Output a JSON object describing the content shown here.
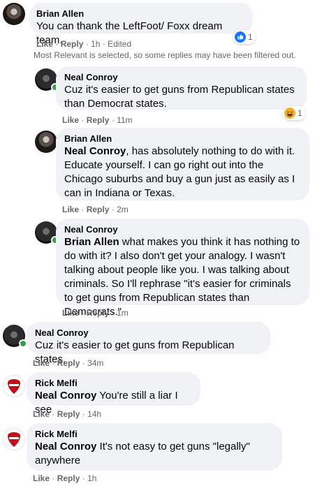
{
  "comments": [
    {
      "author": "Brian Allen",
      "mention": "",
      "text": "You can thank the LeftFoot/ Foxx dream team.",
      "like": "Like",
      "reply": "Reply",
      "time": "1h",
      "edited": "Edited",
      "reaction_count": "1",
      "reaction_type": "like-icon"
    },
    {
      "author": "Neal Conroy",
      "mention": "",
      "text": "Cuz it's easier to get guns from Republican states than Democrat states.",
      "like": "Like",
      "reply": "Reply",
      "time": "11m",
      "reaction_count": "1",
      "reaction_type": "haha-icon"
    },
    {
      "author": "Brian Allen",
      "mention": "Neal Conroy",
      "text": ", has absolutely nothing to do with it. Educate yourself. I can go right out into the Chicago suburbs and buy a gun just as easily as I can in Indiana or Texas.",
      "like": "Like",
      "reply": "Reply",
      "time": "2m"
    },
    {
      "author": "Neal Conroy",
      "mention": "Brian Allen",
      "text": " what makes you think it has nothing to do with it? I also don't get your analogy. I wasn't talking about people like you. I was talking about criminals. So I'll rephrase \"it's easier for criminals to get guns from Republican states than Democrats.\"",
      "like": "Like",
      "reply": "Reply",
      "time": "1m"
    },
    {
      "author": "Neal Conroy",
      "mention": "",
      "text": "Cuz it's easier to get guns from Republican states.",
      "like": "Like",
      "reply": "Reply",
      "time": "34m"
    },
    {
      "author": "Rick Melfi",
      "mention": "Neal Conroy",
      "text": " You're still a liar I see",
      "like": "Like",
      "reply": "Reply",
      "time": "14h"
    },
    {
      "author": "Rick Melfi",
      "mention": "Neal Conroy",
      "text": " It's not easy to get guns \"legally\" anywhere",
      "like": "Like",
      "reply": "Reply",
      "time": "1h"
    }
  ],
  "filter_notice": "Most Relevant is selected, so some replies may have been filtered out.",
  "separator": "·",
  "colors": {
    "bubble": "#f0f2f5",
    "meta": "#65676b",
    "online": "#31a24c",
    "like_blue": "#1877f2",
    "haha_yellow": "#f7b125"
  }
}
